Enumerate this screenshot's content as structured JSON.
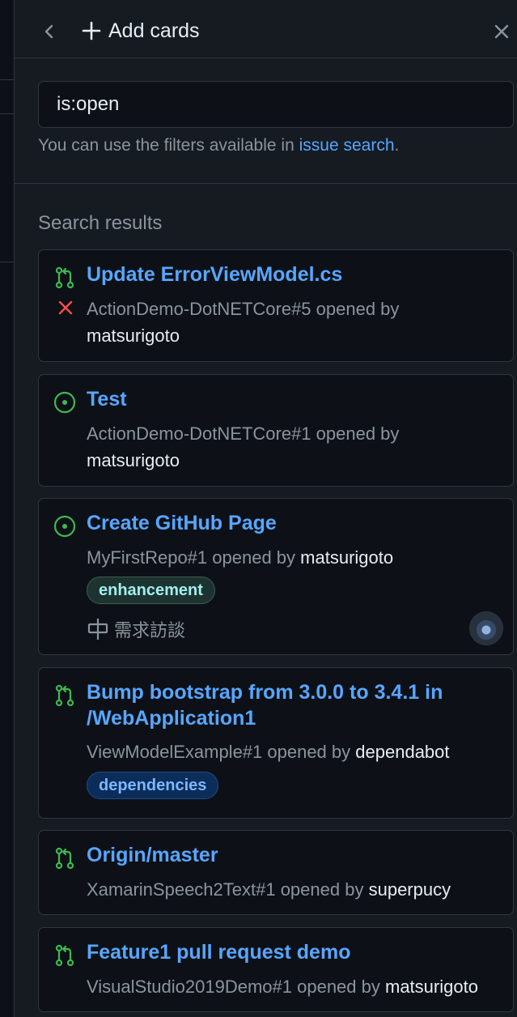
{
  "header": {
    "title": "Add cards"
  },
  "filter": {
    "search_value": "is:open",
    "hint_prefix": "You can use the filters available in ",
    "hint_link": "issue search",
    "hint_suffix": "."
  },
  "results": {
    "heading": "Search results",
    "cards": [
      {
        "type": "pull-request",
        "title": "Update ErrorViewModel.cs",
        "status": "failed",
        "ref": "ActionDemo-DotNETCore#5 opened by",
        "user": "matsurigoto"
      },
      {
        "type": "issue",
        "title": "Test",
        "ref": "ActionDemo-DotNETCore#1 opened by",
        "user": "matsurigoto"
      },
      {
        "type": "issue",
        "title": "Create GitHub Page",
        "ref": "MyFirstRepo#1 opened by",
        "user": "matsurigoto",
        "label": "enhancement",
        "milestone": "需求訪談",
        "has_avatar": true
      },
      {
        "type": "pull-request",
        "title": "Bump bootstrap from 3.0.0 to 3.4.1 in /WebApplication1",
        "ref": "ViewModelExample#1 opened by",
        "user": "dependabot",
        "label": "dependencies"
      },
      {
        "type": "pull-request",
        "title": "Origin/master",
        "ref": "XamarinSpeech2Text#1 opened by",
        "user": "superpucy"
      },
      {
        "type": "pull-request",
        "title": "Feature1 pull request demo",
        "ref": "VisualStudio2019Demo#1 opened by",
        "user": "matsurigoto"
      }
    ]
  },
  "colors": {
    "background": "#0d1117",
    "panel": "#161b22",
    "border": "#30363d",
    "link": "#58a6ff",
    "open_green": "#3fb950",
    "fail_red": "#f85149",
    "label_enhancement_text": "#a2eeef",
    "label_dependencies_text": "#79b8ff"
  }
}
